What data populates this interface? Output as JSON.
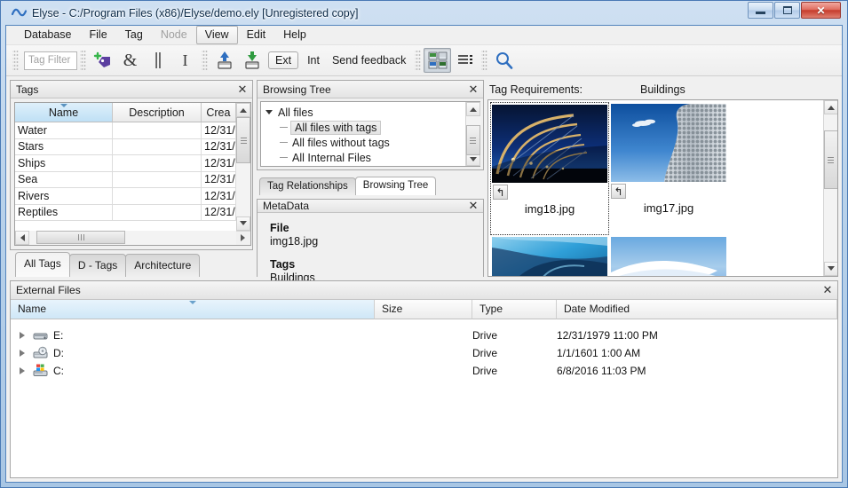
{
  "window": {
    "title": "Elyse - C:/Program Files (x86)/Elyse/demo.ely [Unregistered copy]",
    "app_icon": "wave-icon",
    "minimize_label": "–",
    "maximize_label": "□",
    "close_label": "✕"
  },
  "menubar": {
    "items": [
      {
        "label": "Database",
        "state": "normal"
      },
      {
        "label": "File",
        "state": "normal"
      },
      {
        "label": "Tag",
        "state": "normal"
      },
      {
        "label": "Node",
        "state": "disabled"
      },
      {
        "label": "View",
        "state": "active"
      },
      {
        "label": "Edit",
        "state": "normal"
      },
      {
        "label": "Help",
        "state": "normal"
      }
    ]
  },
  "toolbar": {
    "tag_filter_placeholder": "Tag Filter",
    "add_tag_icon": "tag-plus-icon",
    "and_label": "&",
    "or_label": "||",
    "not_label": "I",
    "export_icon": "export-up-arrow-icon",
    "import_icon": "import-down-arrow-icon",
    "ext_label": "Ext",
    "int_label": "Int",
    "feedback_label": "Send feedback",
    "thumbnail_view_icon": "thumbnail-grid-icon",
    "list_view_icon": "list-view-icon",
    "search_icon": "search-magnifier-icon"
  },
  "tags_panel": {
    "title": "Tags",
    "close_label": "✕",
    "columns": [
      "Name",
      "Description",
      "Crea"
    ],
    "sorted_column": "Name",
    "rows": [
      {
        "name": "Water",
        "description": "",
        "created": "12/31/"
      },
      {
        "name": "Stars",
        "description": "",
        "created": "12/31/"
      },
      {
        "name": "Ships",
        "description": "",
        "created": "12/31/"
      },
      {
        "name": "Sea",
        "description": "",
        "created": "12/31/"
      },
      {
        "name": "Rivers",
        "description": "",
        "created": "12/31/"
      },
      {
        "name": "Reptiles",
        "description": "",
        "created": "12/31/"
      }
    ],
    "tabs": [
      {
        "label": "All Tags",
        "active": true
      },
      {
        "label": "D - Tags",
        "active": false
      },
      {
        "label": "Architecture",
        "active": false
      }
    ]
  },
  "browsing_panel": {
    "title": "Browsing Tree",
    "close_label": "✕",
    "tree": [
      {
        "label": "All files",
        "level": 0,
        "expanded": true,
        "selected": false
      },
      {
        "label": "All files with tags",
        "level": 1,
        "expanded": false,
        "selected": true
      },
      {
        "label": "All files without tags",
        "level": 1,
        "expanded": false,
        "selected": false
      },
      {
        "label": "All Internal Files",
        "level": 1,
        "expanded": false,
        "selected": false
      }
    ],
    "tabs": [
      {
        "label": "Tag Relationships",
        "active": false
      },
      {
        "label": "Browsing Tree",
        "active": true
      }
    ]
  },
  "metadata_panel": {
    "title": "MetaData",
    "close_label": "✕",
    "fields": [
      {
        "key": "File",
        "value": "img18.jpg"
      },
      {
        "key": "Tags",
        "value": "Buildings"
      }
    ]
  },
  "thumbnail_panel": {
    "tag_requirements_label": "Tag Requirements:",
    "tag_requirements_value": "Buildings",
    "rotate_icon": "rotate-left-icon",
    "items": [
      {
        "name": "img18.jpg",
        "selected": true,
        "image": "bridge-night"
      },
      {
        "name": "img17.jpg",
        "selected": false,
        "image": "selfridges"
      },
      {
        "name": "",
        "selected": false,
        "image": "blue-curve-a"
      },
      {
        "name": "",
        "selected": false,
        "image": "blue-curve-b"
      }
    ]
  },
  "external_files": {
    "title": "External Files",
    "close_label": "✕",
    "columns": [
      "Name",
      "Size",
      "Type",
      "Date Modified"
    ],
    "sorted_column": "Name",
    "rows": [
      {
        "name": "E:",
        "icon": "hard-drive-icon",
        "size": "",
        "type": "Drive",
        "date_modified": "12/31/1979 11:00 PM"
      },
      {
        "name": "D:",
        "icon": "cd-drive-icon",
        "size": "",
        "type": "Drive",
        "date_modified": "1/1/1601 1:00 AM"
      },
      {
        "name": "C:",
        "icon": "system-drive-icon",
        "size": "",
        "type": "Drive",
        "date_modified": "6/8/2016 11:03 PM"
      }
    ]
  },
  "colors": {
    "frame": "#5484bd",
    "title_text": "#0c2a47",
    "close_button": "#c63c2c",
    "sort_highlight": "#bfe0f5",
    "accent_tag": "#5b3fa0"
  }
}
